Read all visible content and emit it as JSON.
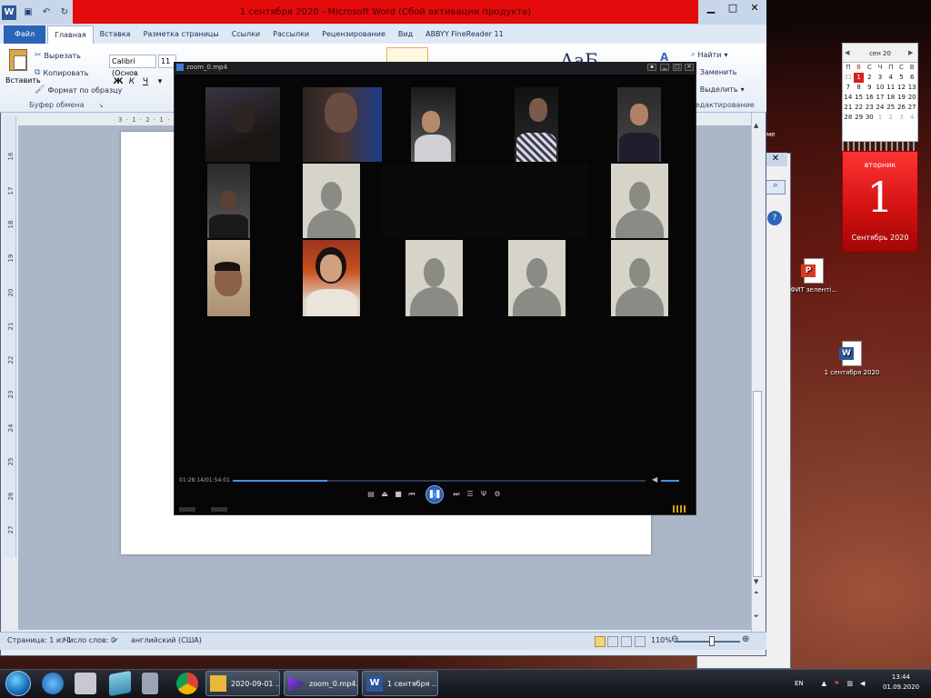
{
  "word": {
    "title": "1 сентября 2020 - Microsoft Word (Сбой активации продукта)",
    "tabs": [
      "Файл",
      "Главная",
      "Вставка",
      "Разметка страницы",
      "Ссылки",
      "Рассылки",
      "Рецензирование",
      "Вид",
      "ABBYY FineReader 11"
    ],
    "clipboard": {
      "paste": "Вставить",
      "cut": "Вырезать",
      "copy": "Копировать",
      "format_painter": "Формат по образцу",
      "group_label": "Буфер обмена"
    },
    "font": {
      "name": "Calibri (Основ",
      "size": "11",
      "bold": "Ж",
      "italic": "К",
      "underline": "Ч"
    },
    "editing": {
      "find": "Найти",
      "replace": "Заменить",
      "select": "Выделить",
      "group_label": "Редактирование"
    },
    "ruler_top": "3 · 1 · 2 · 1 · 1",
    "ruler_left": [
      "16",
      "17",
      "18",
      "19",
      "20",
      "21",
      "22",
      "23",
      "24",
      "25",
      "26",
      "27"
    ],
    "status": {
      "page": "Страница: 1 из 1",
      "words": "Число слов: 0",
      "language": "английский (США)",
      "zoom": "110%"
    }
  },
  "player": {
    "title": "zoom_0.mp4",
    "time": "01:28:14/01:54:01",
    "progress": 0.23
  },
  "calendar": {
    "month_header": "сен 20",
    "weekdays": [
      "П",
      "В",
      "С",
      "Ч",
      "П",
      "С",
      "В"
    ],
    "rows": [
      [
        "31",
        "1",
        "2",
        "3",
        "4",
        "5",
        "6"
      ],
      [
        "7",
        "8",
        "9",
        "10",
        "11",
        "12",
        "13"
      ],
      [
        "14",
        "15",
        "16",
        "17",
        "18",
        "19",
        "20"
      ],
      [
        "21",
        "22",
        "23",
        "24",
        "25",
        "26",
        "27"
      ],
      [
        "28",
        "29",
        "30",
        "1",
        "2",
        "3",
        "4"
      ]
    ],
    "weekday_name": "вторник",
    "day": "1",
    "month_year": "Сентябрь 2020"
  },
  "desktop_icons": [
    {
      "label": "ФИТ зеленті...",
      "type": "pdf"
    },
    {
      "label": "1 сентября 2020",
      "type": "word"
    }
  ],
  "bg_window_text": "ме",
  "taskbar": {
    "tasks": [
      {
        "label": "2020-09-01 ...",
        "icon": "folder-icon"
      },
      {
        "label": "zoom_0.mp4...",
        "icon": "media-player-icon"
      },
      {
        "label": "1 сентября ...",
        "icon": "word-icon"
      }
    ],
    "lang": "EN",
    "time": "13:44",
    "date": "01.09.2020"
  },
  "colors": {
    "word_blue": "#2b579a",
    "title_red": "#e30b0b",
    "player_accent": "#4b8ee8",
    "calendar_red": "#d01010"
  }
}
